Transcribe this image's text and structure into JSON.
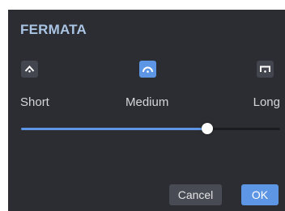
{
  "dialog": {
    "title": "FERMATA"
  },
  "options": {
    "short": {
      "label": "Short",
      "icon": "short-fermata-icon"
    },
    "medium": {
      "label": "Medium",
      "icon": "medium-fermata-icon",
      "selected": true
    },
    "long": {
      "label": "Long",
      "icon": "long-fermata-icon"
    }
  },
  "slider": {
    "value": 0.72
  },
  "buttons": {
    "cancel_label": "Cancel",
    "ok_label": "OK"
  },
  "colors": {
    "accent": "#5d96e4",
    "panel_bg": "#2b2d32",
    "title": "#aac4e4"
  }
}
